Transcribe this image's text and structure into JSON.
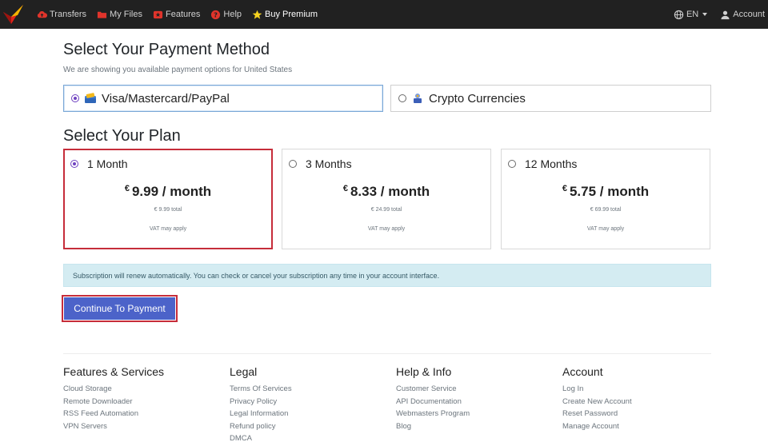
{
  "nav": {
    "items": [
      {
        "label": "Transfers",
        "icon": "cloud-upload-icon"
      },
      {
        "label": "My Files",
        "icon": "folder-icon"
      },
      {
        "label": "Features",
        "icon": "star-icon"
      },
      {
        "label": "Help",
        "icon": "help-icon"
      },
      {
        "label": "Buy Premium",
        "icon": "premium-star-icon"
      }
    ],
    "language": "EN",
    "account": "Account",
    "accent": "#c62d3a"
  },
  "payment": {
    "title": "Select Your Payment Method",
    "subtitle": "We are showing you available payment options for United States",
    "methods": [
      {
        "label": "Visa/Mastercard/PayPal",
        "selected": true,
        "icon": "wallet-icon"
      },
      {
        "label": "Crypto Currencies",
        "selected": false,
        "icon": "crypto-icon"
      }
    ]
  },
  "plans": {
    "title": "Select Your Plan",
    "items": [
      {
        "name": "1 Month",
        "currency": "€",
        "price": "9.99 / month",
        "total": "€ 9.99 total",
        "vat": "VAT may apply",
        "selected": true
      },
      {
        "name": "3 Months",
        "currency": "€",
        "price": "8.33 / month",
        "total": "€ 24.99 total",
        "vat": "VAT may apply",
        "selected": false
      },
      {
        "name": "12 Months",
        "currency": "€",
        "price": "5.75 / month",
        "total": "€ 69.99 total",
        "vat": "VAT may apply",
        "selected": false
      }
    ]
  },
  "notice": "Subscription will renew automatically. You can check or cancel your subscription any time in your account interface.",
  "cta": "Continue To Payment",
  "footer": {
    "columns": [
      {
        "title": "Features & Services",
        "links": [
          "Cloud Storage",
          "Remote Downloader",
          "RSS Feed Automation",
          "VPN Servers"
        ]
      },
      {
        "title": "Legal",
        "links": [
          "Terms Of Services",
          "Privacy Policy",
          "Legal Information",
          "Refund policy",
          "DMCA"
        ]
      },
      {
        "title": "Help & Info",
        "links": [
          "Customer Service",
          "API Documentation",
          "Webmasters Program",
          "Blog"
        ]
      },
      {
        "title": "Account",
        "links": [
          "Log In",
          "Create New Account",
          "Reset Password",
          "Manage Account"
        ]
      }
    ]
  }
}
